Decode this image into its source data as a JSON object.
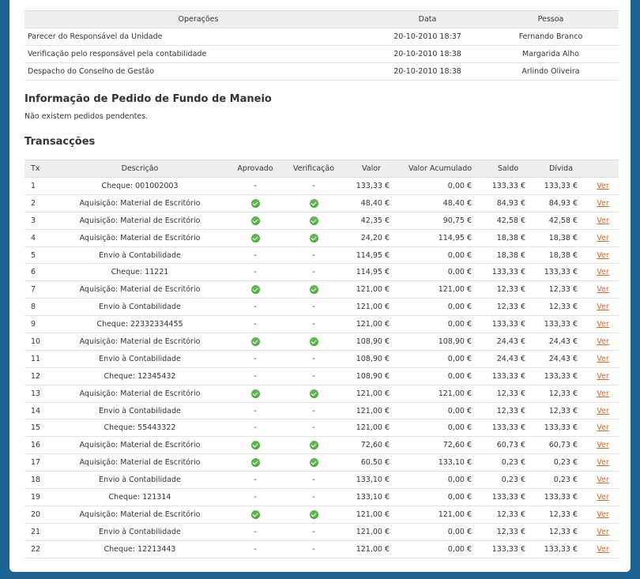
{
  "operations": {
    "headers": [
      "Operações",
      "Data",
      "Pessoa"
    ],
    "rows": [
      {
        "op": "Parecer do Responsável da Unidade",
        "date": "20-10-2010 18:37",
        "person": "Fernando Branco"
      },
      {
        "op": "Verificação pelo responsável pela contabilidade",
        "date": "20-10-2010 18:38",
        "person": "Margarida Alho"
      },
      {
        "op": "Despacho do Conselho de Gestão",
        "date": "20-10-2010 18:38",
        "person": "Arlindo Oliveira"
      }
    ]
  },
  "fundo": {
    "title": "Informação de Pedido de Fundo de Maneio",
    "message": "Não existem pedidos pendentes."
  },
  "transactions": {
    "title": "Transacções",
    "headers": [
      "Tx",
      "Descrição",
      "Aprovado",
      "Verificação",
      "Valor",
      "Valor Acumulado",
      "Saldo",
      "Dívida",
      ""
    ],
    "link_label": "Ver",
    "link_color": "#d9642a",
    "check_color": "#5bb84a",
    "rows": [
      {
        "tx": "1",
        "desc": "Cheque: 001002003",
        "aprovado": "-",
        "verif": "-",
        "valor": "133,33 €",
        "acum": "0,00 €",
        "saldo": "133,33 €",
        "divida": "133,33 €"
      },
      {
        "tx": "2",
        "desc": "Aquisição: Material de Escritório",
        "aprovado": "check",
        "verif": "check",
        "valor": "48,40 €",
        "acum": "48,40 €",
        "saldo": "84,93 €",
        "divida": "84,93 €"
      },
      {
        "tx": "3",
        "desc": "Aquisição: Material de Escritório",
        "aprovado": "check",
        "verif": "check",
        "valor": "42,35 €",
        "acum": "90,75 €",
        "saldo": "42,58 €",
        "divida": "42,58 €"
      },
      {
        "tx": "4",
        "desc": "Aquisição: Material de Escritório",
        "aprovado": "check",
        "verif": "check",
        "valor": "24,20 €",
        "acum": "114,95 €",
        "saldo": "18,38 €",
        "divida": "18,38 €"
      },
      {
        "tx": "5",
        "desc": "Envio à Contabilidade",
        "aprovado": "-",
        "verif": "-",
        "valor": "114,95 €",
        "acum": "0,00 €",
        "saldo": "18,38 €",
        "divida": "18,38 €"
      },
      {
        "tx": "6",
        "desc": "Cheque: 11221",
        "aprovado": "-",
        "verif": "-",
        "valor": "114,95 €",
        "acum": "0,00 €",
        "saldo": "133,33 €",
        "divida": "133,33 €"
      },
      {
        "tx": "7",
        "desc": "Aquisição: Material de Escritório",
        "aprovado": "check",
        "verif": "check",
        "valor": "121,00 €",
        "acum": "121,00 €",
        "saldo": "12,33 €",
        "divida": "12,33 €"
      },
      {
        "tx": "8",
        "desc": "Envio à Contabilidade",
        "aprovado": "-",
        "verif": "-",
        "valor": "121,00 €",
        "acum": "0,00 €",
        "saldo": "12,33 €",
        "divida": "12,33 €"
      },
      {
        "tx": "9",
        "desc": "Cheque: 22332334455",
        "aprovado": "-",
        "verif": "-",
        "valor": "121,00 €",
        "acum": "0,00 €",
        "saldo": "133,33 €",
        "divida": "133,33 €"
      },
      {
        "tx": "10",
        "desc": "Aquisição: Material de Escritório",
        "aprovado": "check",
        "verif": "check",
        "valor": "108,90 €",
        "acum": "108,90 €",
        "saldo": "24,43 €",
        "divida": "24,43 €"
      },
      {
        "tx": "11",
        "desc": "Envio à Contabilidade",
        "aprovado": "-",
        "verif": "-",
        "valor": "108,90 €",
        "acum": "0,00 €",
        "saldo": "24,43 €",
        "divida": "24,43 €"
      },
      {
        "tx": "12",
        "desc": "Cheque: 12345432",
        "aprovado": "-",
        "verif": "-",
        "valor": "108,90 €",
        "acum": "0,00 €",
        "saldo": "133,33 €",
        "divida": "133,33 €"
      },
      {
        "tx": "13",
        "desc": "Aquisição: Material de Escritório",
        "aprovado": "check",
        "verif": "check",
        "valor": "121,00 €",
        "acum": "121,00 €",
        "saldo": "12,33 €",
        "divida": "12,33 €"
      },
      {
        "tx": "14",
        "desc": "Envio à Contabilidade",
        "aprovado": "-",
        "verif": "-",
        "valor": "121,00 €",
        "acum": "0,00 €",
        "saldo": "12,33 €",
        "divida": "12,33 €"
      },
      {
        "tx": "15",
        "desc": "Cheque: 55443322",
        "aprovado": "-",
        "verif": "-",
        "valor": "121,00 €",
        "acum": "0,00 €",
        "saldo": "133,33 €",
        "divida": "133,33 €"
      },
      {
        "tx": "16",
        "desc": "Aquisição: Material de Escritório",
        "aprovado": "check",
        "verif": "check",
        "valor": "72,60 €",
        "acum": "72,60 €",
        "saldo": "60,73 €",
        "divida": "60,73 €"
      },
      {
        "tx": "17",
        "desc": "Aquisição: Material de Escritório",
        "aprovado": "check",
        "verif": "check",
        "valor": "60,50 €",
        "acum": "133,10 €",
        "saldo": "0,23 €",
        "divida": "0,23 €"
      },
      {
        "tx": "18",
        "desc": "Envio à Contabilidade",
        "aprovado": "-",
        "verif": "-",
        "valor": "133,10 €",
        "acum": "0,00 €",
        "saldo": "0,23 €",
        "divida": "0,23 €"
      },
      {
        "tx": "19",
        "desc": "Cheque: 121314",
        "aprovado": "-",
        "verif": "-",
        "valor": "133,10 €",
        "acum": "0,00 €",
        "saldo": "133,33 €",
        "divida": "133,33 €"
      },
      {
        "tx": "20",
        "desc": "Aquisição: Material de Escritório",
        "aprovado": "check",
        "verif": "check",
        "valor": "121,00 €",
        "acum": "121,00 €",
        "saldo": "12,33 €",
        "divida": "12,33 €"
      },
      {
        "tx": "21",
        "desc": "Envio à Contabilidade",
        "aprovado": "-",
        "verif": "-",
        "valor": "121,00 €",
        "acum": "0,00 €",
        "saldo": "12,33 €",
        "divida": "12,33 €"
      },
      {
        "tx": "22",
        "desc": "Cheque: 12213443",
        "aprovado": "-",
        "verif": "-",
        "valor": "121,00 €",
        "acum": "0,00 €",
        "saldo": "133,33 €",
        "divida": "133,33 €"
      }
    ]
  }
}
